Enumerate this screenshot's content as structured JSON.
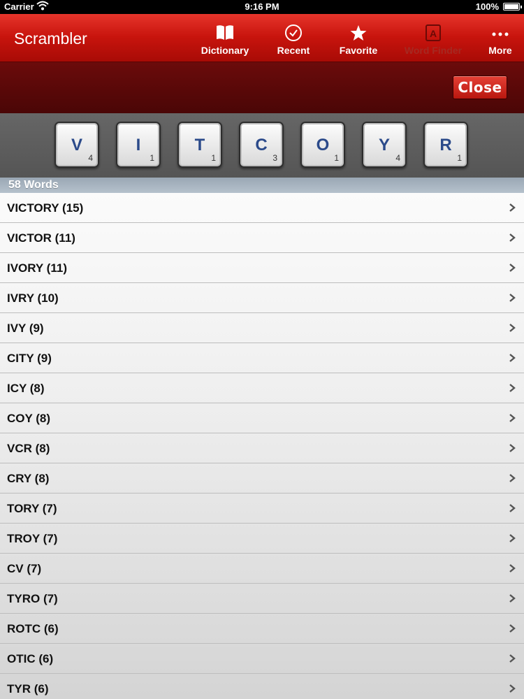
{
  "status_bar": {
    "carrier": "Carrier",
    "time": "9:16 PM",
    "battery": "100%"
  },
  "navbar": {
    "title": "Scrambler",
    "buttons": [
      {
        "label": "Dictionary",
        "icon": "book-icon"
      },
      {
        "label": "Recent",
        "icon": "check-circle-icon"
      },
      {
        "label": "Favorite",
        "icon": "star-icon"
      },
      {
        "label": "Word Finder",
        "icon": "letter-a-icon"
      },
      {
        "label": "More",
        "icon": "ellipsis-icon"
      }
    ]
  },
  "close_button": {
    "label": "Close"
  },
  "tiles": [
    {
      "letter": "V",
      "points": "4"
    },
    {
      "letter": "I",
      "points": "1"
    },
    {
      "letter": "T",
      "points": "1"
    },
    {
      "letter": "C",
      "points": "3"
    },
    {
      "letter": "O",
      "points": "1"
    },
    {
      "letter": "Y",
      "points": "4"
    },
    {
      "letter": "R",
      "points": "1"
    }
  ],
  "section_header": "58 Words",
  "words": [
    "VICTORY (15)",
    "VICTOR (11)",
    "IVORY (11)",
    "IVRY (10)",
    "IVY (9)",
    "CITY (9)",
    "ICY (8)",
    "COY (8)",
    "VCR (8)",
    "CRY (8)",
    "TORY (7)",
    "TROY (7)",
    "CV (7)",
    "TYRO (7)",
    "ROTC (6)",
    "OTIC (6)",
    "TYR (6)"
  ],
  "colors": {
    "navbar": "#c8140d",
    "tile_letter": "#2b4a8a",
    "close_bar": "#5a0808"
  }
}
